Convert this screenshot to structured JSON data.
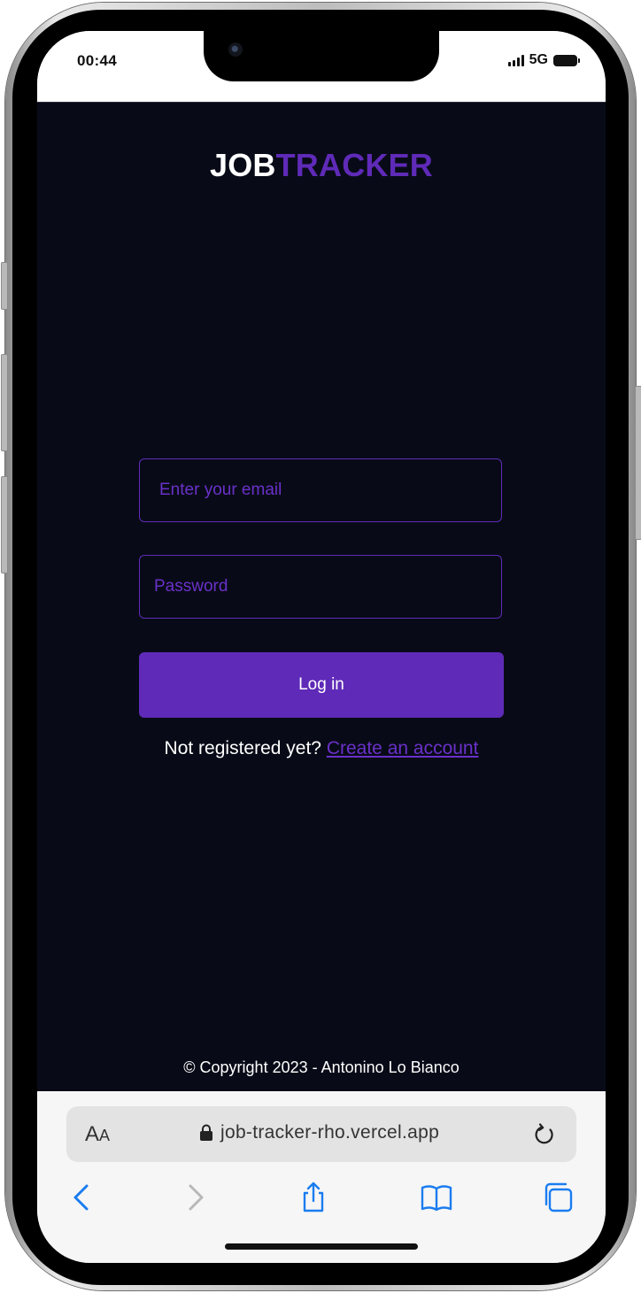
{
  "status_bar": {
    "time": "00:44",
    "network": "5G"
  },
  "app": {
    "logo_part1": "JOB",
    "logo_part2": "TRACKER",
    "email_placeholder": "Enter your email",
    "password_placeholder": "Password",
    "login_label": "Log in",
    "register_prompt": "Not registered yet?",
    "register_link": "Create an account",
    "copyright": "© Copyright 2023 - Antonino Lo Bianco"
  },
  "browser": {
    "text_size_label_big": "A",
    "text_size_label_small": "A",
    "url": "job-tracker-rho.vercel.app"
  },
  "colors": {
    "background": "#080b17",
    "accent": "#5f2ab8",
    "ios_blue": "#1a7cf0"
  },
  "icons": [
    "lock-icon",
    "reload-icon",
    "back-icon",
    "forward-icon",
    "share-icon",
    "bookmarks-icon",
    "tabs-icon"
  ]
}
